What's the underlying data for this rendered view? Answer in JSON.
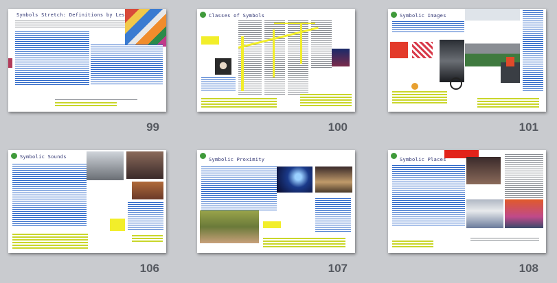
{
  "slides": [
    {
      "number": "99",
      "title": "Symbols Stretch: Definitions by Lessons"
    },
    {
      "number": "100",
      "title": "Classes of Symbols"
    },
    {
      "number": "101",
      "title": "Symbolic Images"
    },
    {
      "number": "106",
      "title": "Symbolic Sounds"
    },
    {
      "number": "107",
      "title": "Symbolic Proximity"
    },
    {
      "number": "108",
      "title": "Symbolic Places"
    }
  ],
  "colors": {
    "background": "#c9cbcf",
    "page_number": "#555960",
    "text_lines": "#2b66c8",
    "highlight": "#f2ee2a",
    "logo": "#3f9a3a"
  }
}
